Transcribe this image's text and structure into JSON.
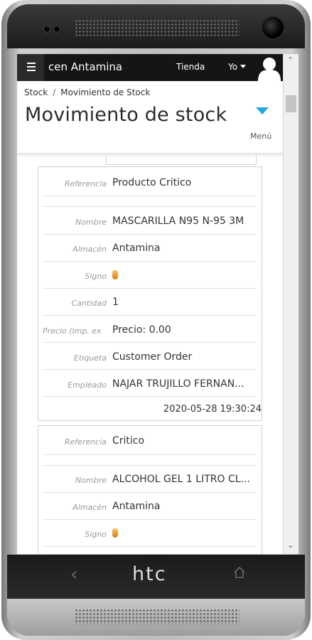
{
  "device": {
    "brand_logo": "htc"
  },
  "topbar": {
    "title": "cen Antamina",
    "tienda": "Tienda",
    "user": "Yo"
  },
  "breadcrumb": {
    "root": "Stock",
    "current": "Movimiento de Stock"
  },
  "page": {
    "title": "Movimiento de stock",
    "menu_label": "Menú"
  },
  "labels": {
    "referencia": "Referencia",
    "nombre": "Nombre",
    "almacen": "Almacén",
    "signo": "Signo",
    "cantidad": "Cantidad",
    "precio": "Precio (imp. ex",
    "etiqueta": "Etiqueta",
    "empleado": "Empleado"
  },
  "movements": [
    {
      "referencia": "Producto Critico",
      "nombre": "MASCARILLA N95 N-95 3M",
      "almacen": "Antamina",
      "cantidad": "1",
      "precio": "Precio: 0.00",
      "etiqueta": "Customer Order",
      "empleado": "NAJAR TRUJILLO FERNAN...",
      "fecha": "2020-05-28 19:30:24"
    },
    {
      "referencia": "Critico",
      "nombre": "ALCOHOL GEL 1 LITRO CL...",
      "almacen": "Antamina"
    }
  ],
  "colors": {
    "topbar": "#151515",
    "accent": "#29a5e0"
  }
}
